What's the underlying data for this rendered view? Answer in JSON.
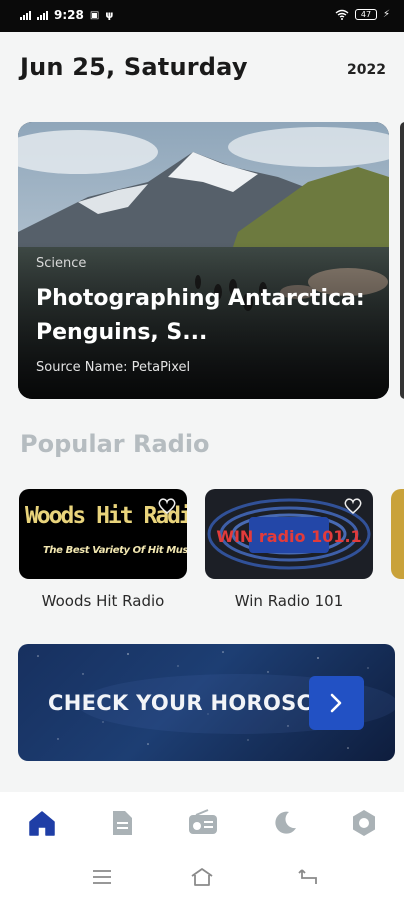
{
  "status_bar": {
    "time": "9:28",
    "battery": "47"
  },
  "header": {
    "date": "Jun 25, Saturday",
    "year": "2022"
  },
  "featured": {
    "category": "Science",
    "title": "Photographing Antarctica: Penguins, S...",
    "source": "Source Name: PetaPixel"
  },
  "popular_radio": {
    "heading": "Popular Radio",
    "stations": [
      {
        "name": "Woods Hit Radio",
        "logo_text": "Woods Hit Radio",
        "logo_subtext": "The Best Variety Of Hit Music"
      },
      {
        "name": "Win Radio 101",
        "logo_text": "WIN radio 101.1"
      }
    ]
  },
  "horoscope": {
    "label": "CHECK YOUR HOROSCOPE"
  },
  "bottom_nav": {
    "items": [
      {
        "icon": "home-icon",
        "active": true
      },
      {
        "icon": "document-icon",
        "active": false
      },
      {
        "icon": "radio-icon",
        "active": false
      },
      {
        "icon": "moon-icon",
        "active": false
      },
      {
        "icon": "settings-icon",
        "active": false
      }
    ]
  },
  "colors": {
    "accent": "#1f3ea6",
    "inactive": "#aab2b6",
    "heading_muted": "#b5bcc0",
    "banner_button": "#2251c4"
  }
}
